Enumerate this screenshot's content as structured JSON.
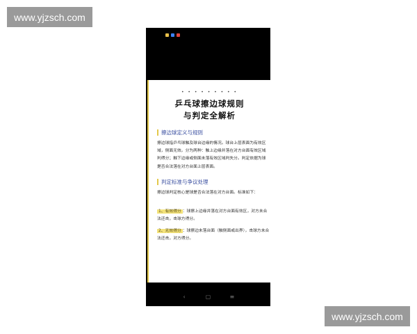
{
  "watermark": {
    "top": "www.yjzsch.com",
    "bottom": "www.yjzsch.com"
  },
  "phone": {
    "status_icon_colors": [
      "#e8c04a",
      "#3b82f6",
      "#e0443a"
    ],
    "article": {
      "dots": "• • • • • • • • •",
      "title_line1": "乒乓球擦边球规则",
      "title_line2": "与判定全解析",
      "section1": {
        "heading": "擦边球定义与规则",
        "body": "擦边球指乒乓球触及球台边缘的情况。球台上层表面为有效区域，侧面无效。分为两种：触上边缘并落在对方台面有效区域判得分；触下边缘或侧面未落有效区域判失分。判定依据为球是否合法落在对方台面上层表面。"
      },
      "section2": {
        "heading": "判定标准与争议处理",
        "intro": "擦边球判定核心是球是否合法落在对方台面。标准如下：",
        "items": [
          {
            "tag": "1、有效得分",
            "text": "：球擦上边缘并落在对方台面有效区，对方未合法还击，击球方得分。"
          },
          {
            "tag": "2、无效得分",
            "text": "：球擦边未落台面（触侧面或出界），击球方未合法还击，对方得分。"
          }
        ]
      }
    },
    "nav": {
      "back": "‹",
      "home": "▢",
      "menu": "≡"
    }
  }
}
